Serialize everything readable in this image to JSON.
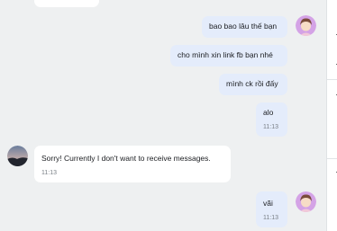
{
  "messages": [
    {
      "direction": "outgoing",
      "text": "bao bao lâu thế bạn",
      "time": ""
    },
    {
      "direction": "outgoing",
      "text": "cho mình xin link fb bạn nhé",
      "time": ""
    },
    {
      "direction": "outgoing",
      "text": "mình ck rồi đấy",
      "time": ""
    },
    {
      "direction": "outgoing",
      "text": "alo",
      "time": "11:13"
    },
    {
      "direction": "incoming",
      "text": "Sorry! Currently I don't want to receive messages.",
      "time": "11:13"
    },
    {
      "direction": "outgoing",
      "text": "vãi",
      "time": "11:13"
    }
  ],
  "colors": {
    "background": "#eef0f1",
    "outgoing_bubble": "#e4ecfb",
    "incoming_bubble": "#ffffff",
    "timestamp": "#7a8087"
  },
  "icons": [
    "user-avatar-icon",
    "contact-avatar-icon"
  ]
}
